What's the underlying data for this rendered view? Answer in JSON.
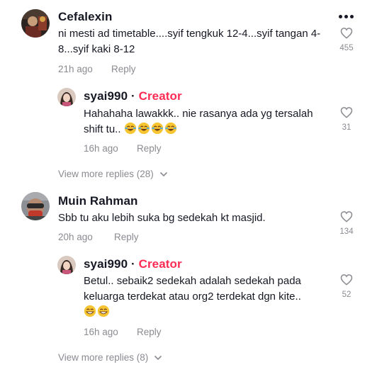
{
  "comments": [
    {
      "username": "Cefalexin",
      "text": "ni mesti ad timetable....syif tengkuk 12-4...syif tangan 4-8...syif kaki 8-12",
      "time": "21h ago",
      "reply_label": "Reply",
      "likes": "455",
      "reply": {
        "username": "syai990",
        "creator_sep": " · ",
        "creator_label": "Creator",
        "text": "Hahahaha lawakkk.. nie rasanya ada yg tersalah shift tu..",
        "emojis": [
          "laughing-crying",
          "laughing-crying",
          "laughing-crying",
          "laughing-crying"
        ],
        "time": "16h ago",
        "reply_label": "Reply",
        "likes": "31"
      },
      "view_more": "View more replies (28)"
    },
    {
      "username": "Muin Rahman",
      "text": "Sbb tu aku lebih suka bg sedekah kt masjid.",
      "time": "20h ago",
      "reply_label": "Reply",
      "likes": "134",
      "reply": {
        "username": "syai990",
        "creator_sep": " · ",
        "creator_label": "Creator",
        "text": "Betul.. sebaik2 sedekah adalah sedekah pada keluarga terdekat atau org2 terdekat dgn kite..",
        "emojis": [
          "grinning",
          "grinning"
        ],
        "time": "16h ago",
        "reply_label": "Reply",
        "likes": "52"
      },
      "view_more": "View more replies (8)"
    }
  ]
}
